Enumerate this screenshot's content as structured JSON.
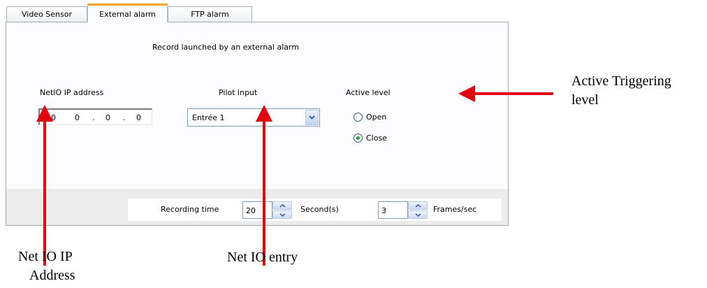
{
  "tabs": [
    {
      "label": "Video Sensor"
    },
    {
      "label": "External alarm"
    },
    {
      "label": "FTP alarm"
    }
  ],
  "panel": {
    "heading": "Record launched by an external alarm",
    "netio": {
      "label": "NetIO IP address",
      "octets": [
        "0",
        "0",
        "0",
        "0"
      ]
    },
    "pilot": {
      "label": "Pilot input",
      "selected": "Entrée 1"
    },
    "active_level": {
      "label": "Active level",
      "options": [
        "Open",
        "Close"
      ],
      "selected": "Close"
    },
    "recording": {
      "label": "Recording time",
      "seconds_value": "20",
      "seconds_unit": "Second(s)",
      "fps_value": "3",
      "fps_unit": "Frames/sec"
    }
  },
  "annotations": {
    "active_triggering": [
      "Active Triggering",
      "level"
    ],
    "netio_ip": [
      "Net IO IP",
      "Address"
    ],
    "netio_entry": "Net IO entry"
  },
  "colors": {
    "arrow": "#e3000f",
    "active_tab_accent": "#f4a51c",
    "radio_dot": "#22a032"
  }
}
